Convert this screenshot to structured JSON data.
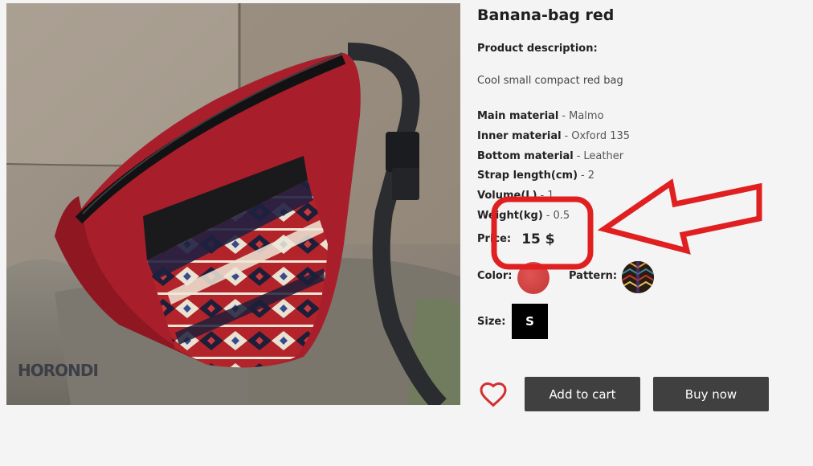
{
  "product": {
    "title": "Banana-bag red",
    "description_heading": "Product description:",
    "description": "Cool small compact red bag",
    "specs": [
      {
        "key": "Main material",
        "value": "Malmo"
      },
      {
        "key": "Inner material",
        "value": "Oxford 135"
      },
      {
        "key": "Bottom material",
        "value": "Leather"
      },
      {
        "key": "Strap length(cm)",
        "value": "2"
      },
      {
        "key": "Volume(L)",
        "value": "1"
      },
      {
        "key": "Weight(kg)",
        "value": "0.5"
      }
    ],
    "spec_separator": "-",
    "price_label": "Price:",
    "price_value": "15 $",
    "color_label": "Color:",
    "pattern_label": "Pattern:",
    "size_label": "Size:",
    "size_value": "S",
    "watermark": "HORONDI"
  },
  "actions": {
    "add_to_cart": "Add to cart",
    "buy_now": "Buy now",
    "wishlist_icon": "heart-icon"
  },
  "colors": {
    "annotation": "#e02020",
    "button_bg": "#404040",
    "swatch_red": "#d44444",
    "heart": "#d32f2f"
  }
}
